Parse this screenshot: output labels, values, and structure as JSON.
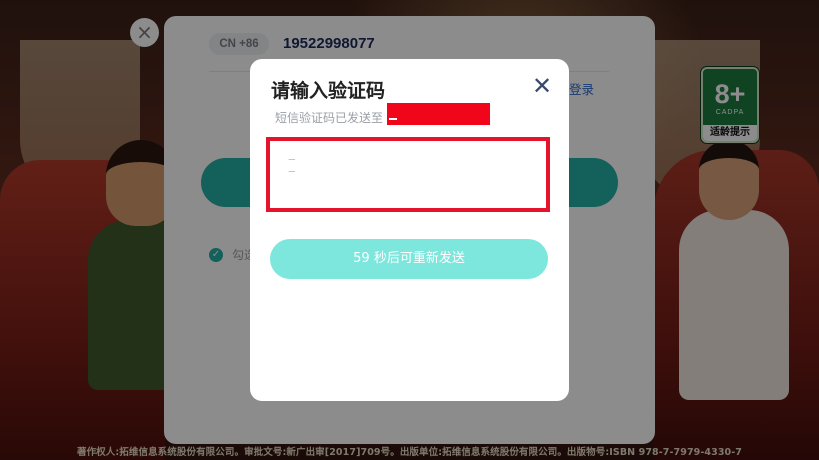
{
  "background": {
    "age_badge": {
      "rating": "8+",
      "org": "CADPA",
      "tip": "适龄提示"
    },
    "copyright": "著作权人:拓维信息系统股份有限公司。审批文号:新广出审[2017]709号。出版单位:拓维信息系统股份有限公司。出版物号:ISBN 978-7-7979-4330-7"
  },
  "login_panel": {
    "close_icon": "×",
    "country_code": "CN +86",
    "phone_number": "19522998077",
    "email_login_label": "邮箱登录",
    "agree_label": "勾选"
  },
  "verify_dialog": {
    "title": "请输入验证码",
    "close_icon": "✕",
    "subtitle": "短信验证码已发送至",
    "code_value": "",
    "resend_label": "59 秒后可重新发送"
  },
  "colors": {
    "accent": "#25b0a4",
    "resend_disabled": "#7de7de",
    "highlight": "#e3142c",
    "redaction": "#f0051a"
  }
}
